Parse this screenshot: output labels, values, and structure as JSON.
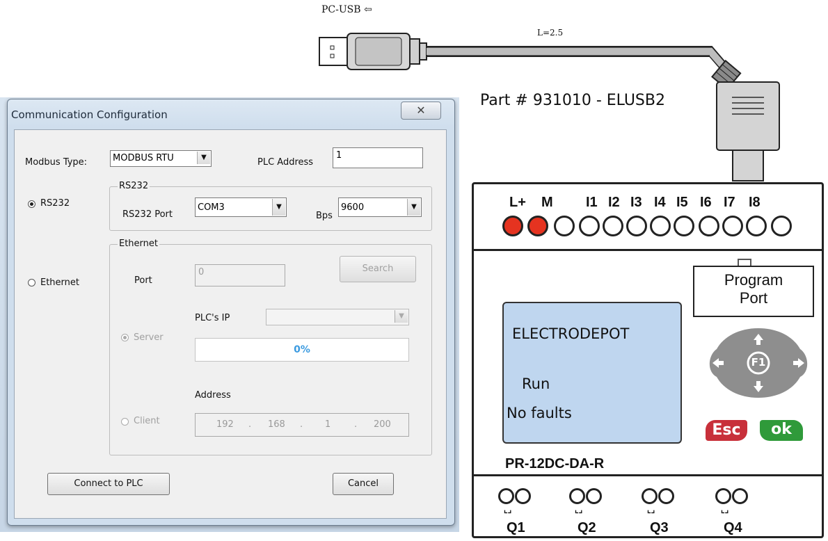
{
  "cable": {
    "connector_label": "PC-USB",
    "arrow": "⇦",
    "length_label": "L=2.5",
    "part_label": "Part # 931010 - ELUSB2"
  },
  "dialog": {
    "title": "Communication Configuration",
    "close_glyph": "✕",
    "modbus_type_label": "Modbus Type:",
    "modbus_type_value": "MODBUS RTU",
    "plc_address_label": "PLC Address",
    "plc_address_value": "1",
    "rs232_radio_label": "RS232",
    "rs232_group_title": "RS232",
    "rs232_port_label": "RS232 Port",
    "rs232_port_value": "COM3",
    "bps_label": "Bps",
    "bps_value": "9600",
    "ethernet_radio_label": "Ethernet",
    "ethernet_group_title": "Ethernet",
    "port_label": "Port",
    "port_value": "0",
    "search_label": "Search",
    "server_label": "Server",
    "plc_ip_label": "PLC's IP",
    "progress_text": "0%",
    "progress_value": 0,
    "address_label": "Address",
    "client_label": "Client",
    "ip_octets": [
      "192",
      "168",
      "1",
      "200"
    ],
    "connect_label": "Connect to PLC",
    "cancel_label": "Cancel",
    "selected_mode": "RS232"
  },
  "plc": {
    "input_labels": [
      "L+",
      "M",
      "I1",
      "I2",
      "I3",
      "I4",
      "I5",
      "I6",
      "I7",
      "I8"
    ],
    "program_port_line1": "Program",
    "program_port_line2": "Port",
    "lcd_line1": "ELECTRODEPOT",
    "lcd_line2": "Run",
    "lcd_line3": "No faults",
    "model": "PR-12DC-DA-R",
    "f1_key": "F1",
    "esc_key": "Esc",
    "ok_key": "ok",
    "output_labels": [
      "Q1",
      "Q2",
      "Q3",
      "Q4"
    ],
    "led_colors": {
      "on": "#e53320",
      "off": "#ffffff"
    },
    "lcd_color": "#bfd6ef",
    "esc_color": "#c8303a",
    "ok_color": "#2f9a3a"
  }
}
